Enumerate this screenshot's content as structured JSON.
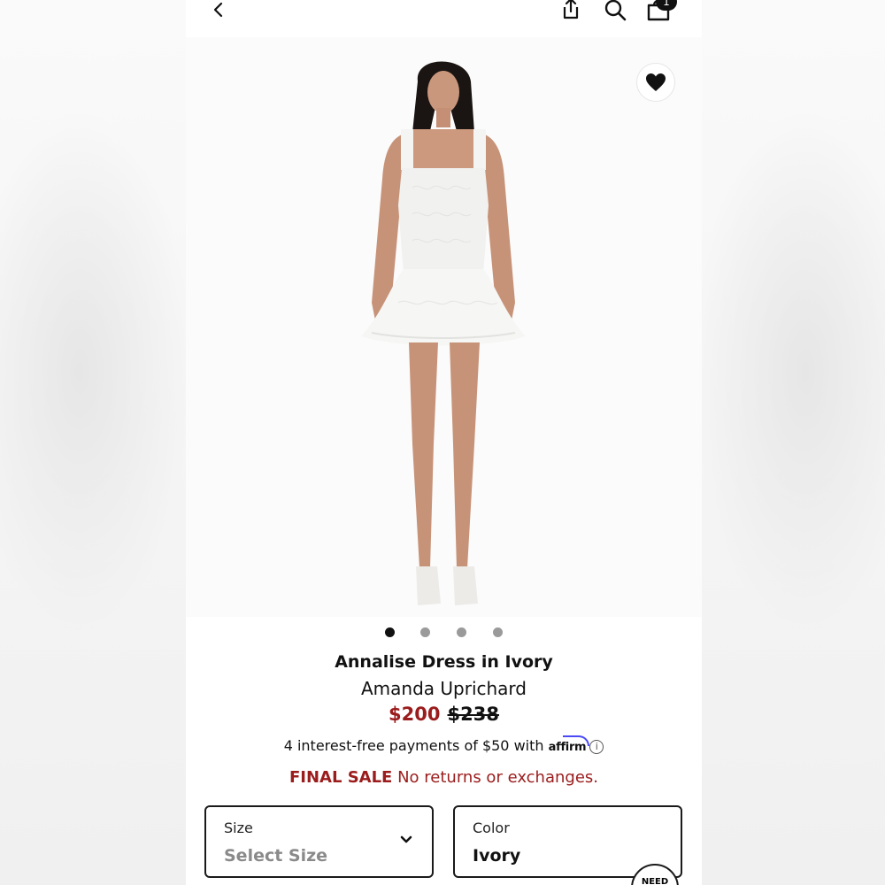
{
  "header": {
    "back_icon": "chevron-left-icon",
    "share_icon": "share-icon",
    "search_icon": "search-icon",
    "bag_icon": "shopping-bag-icon",
    "bag_count": "1"
  },
  "gallery": {
    "favorite_icon": "heart-icon",
    "dots": 4,
    "active_dot": 0
  },
  "product": {
    "title": "Annalise Dress in Ivory",
    "brand": "Amanda Uprichard",
    "sale_price": "$200",
    "original_price": "$238",
    "installment_text": "4 interest-free payments of $50 with",
    "affirm_label": "affirm",
    "final_sale_label": "FINAL SALE",
    "final_sale_text": "No returns or exchanges."
  },
  "selectors": {
    "size_label": "Size",
    "size_value": "Select Size",
    "color_label": "Color",
    "color_value": "Ivory"
  },
  "help": {
    "label": "NEED"
  },
  "colors": {
    "sale": "#9b1c1c",
    "affirm_arc": "#4a4af4"
  }
}
